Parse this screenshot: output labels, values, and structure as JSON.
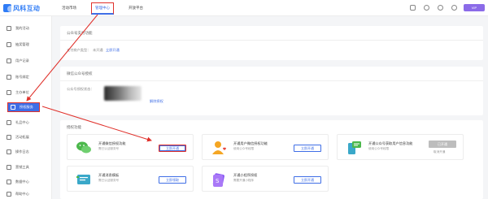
{
  "header": {
    "logo_text": "风科互动",
    "nav": [
      {
        "label": "活动市场"
      },
      {
        "label": "管理中心"
      },
      {
        "label": "开放平台"
      }
    ],
    "badge": "VIP"
  },
  "sidebar": {
    "items": [
      {
        "label": "我的活动",
        "icon": "home-icon"
      },
      {
        "label": "抽奖管理",
        "icon": "gift-icon"
      },
      {
        "label": "用户记录",
        "icon": "user-list-icon"
      },
      {
        "label": "账号绑定",
        "icon": "link-icon"
      },
      {
        "label": "主办单位",
        "icon": "building-icon"
      },
      {
        "label": "授权服务",
        "icon": "shield-icon"
      },
      {
        "label": "礼品中心",
        "icon": "gift-box-icon"
      },
      {
        "label": "活动拓展",
        "icon": "puzzle-icon"
      },
      {
        "label": "操作日志",
        "icon": "log-icon"
      },
      {
        "label": "营销工具",
        "icon": "tool-icon"
      },
      {
        "label": "数据中心",
        "icon": "chart-icon"
      },
      {
        "label": "帮助中心",
        "icon": "help-icon"
      }
    ]
  },
  "section1": {
    "title": "公众号支付功能",
    "label": "支付商户类型：",
    "value": "未开通",
    "link": "立即开通"
  },
  "section2": {
    "title": "微信公众号授权",
    "label": "公众号授权状态：",
    "link": "解除授权"
  },
  "section3": {
    "title": "授权功能",
    "cards": [
      {
        "title": "开通微信授权功能",
        "desc": "需已认证服务号",
        "button": "立即开通",
        "icon": "wechat-chat-icon"
      },
      {
        "title": "开通用户微信授权功能",
        "desc": "使用公众号权限",
        "button": "立即开通",
        "icon": "user-heart-icon"
      },
      {
        "title": "开通公众号获取用户信息功能",
        "desc": "使用公众号权限",
        "button": "已开通",
        "sub": "取消开通",
        "icon": "phone-message-icon"
      },
      {
        "title": "开通消息模板",
        "desc": "需已认证服务号",
        "button": "立即领取",
        "icon": "message-template-icon"
      },
      {
        "title": "开通小程序授权",
        "desc": "需要开通小程序",
        "button": "立即开通",
        "icon": "miniprogram-icon"
      }
    ]
  },
  "colors": {
    "accent": "#3f6ee6",
    "annotation": "#e0302a",
    "wechat_green": "#4cb84c",
    "orange": "#f5a623"
  }
}
